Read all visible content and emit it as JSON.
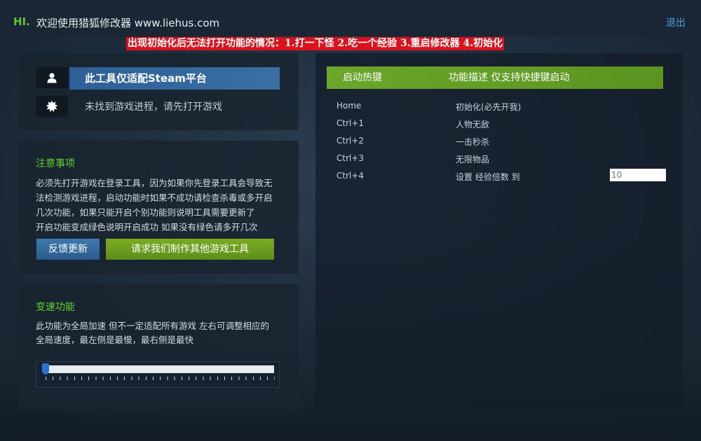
{
  "titlebar": {
    "hi": "HI.",
    "welcome": "欢迎使用猎狐修改器 www.liehus.com",
    "logout": "退出"
  },
  "warning": "出现初始化后无法打开功能的情况：1.打一下怪 2.吃一个经验 3.重启修改器 4.初始化",
  "status_panel": {
    "platform_label": "此工具仅适配Steam平台",
    "process_status": "未找到游戏进程，请先打开游戏",
    "icons": [
      "user-icon",
      "gear-icon"
    ]
  },
  "notes": {
    "title": "注意事项",
    "lines": [
      "必须先打开游戏在登录工具，因为如果你先登录工具会导致无",
      "法检测游戏进程，启动功能时如果不成功请检查杀毒或多开启",
      "几次功能，如果只能开启个别功能则说明工具需要更新了",
      "开启功能变成绿色说明开启成功 如果没有绿色请多开几次"
    ],
    "feedback_button": "反馈更新",
    "request_button": "请求我们制作其他游戏工具"
  },
  "speed": {
    "title": "变速功能",
    "lines": [
      "此功能为全局加速 但不一定适配所有游戏 左右可调整相应的",
      "全局速度，最左侧是最慢，最右侧是最快"
    ],
    "slider_value": 0
  },
  "hotkeys": {
    "header_key": "启动热键",
    "header_desc": "功能描述 仅支持快捷键启动",
    "rows": [
      {
        "key": "Home",
        "desc": "初始化(必先开我)"
      },
      {
        "key": "Ctrl+1",
        "desc": "人物无敌"
      },
      {
        "key": "Ctrl+2",
        "desc": "一击秒杀"
      },
      {
        "key": "Ctrl+3",
        "desc": "无限物品"
      },
      {
        "key": "Ctrl+4",
        "desc": "设置 经验倍数 到",
        "input_placeholder": "10"
      }
    ]
  },
  "colors": {
    "accent_green": "#5fd12e",
    "steam_blue": "#2d5f96",
    "warning_red": "#d9131d"
  }
}
